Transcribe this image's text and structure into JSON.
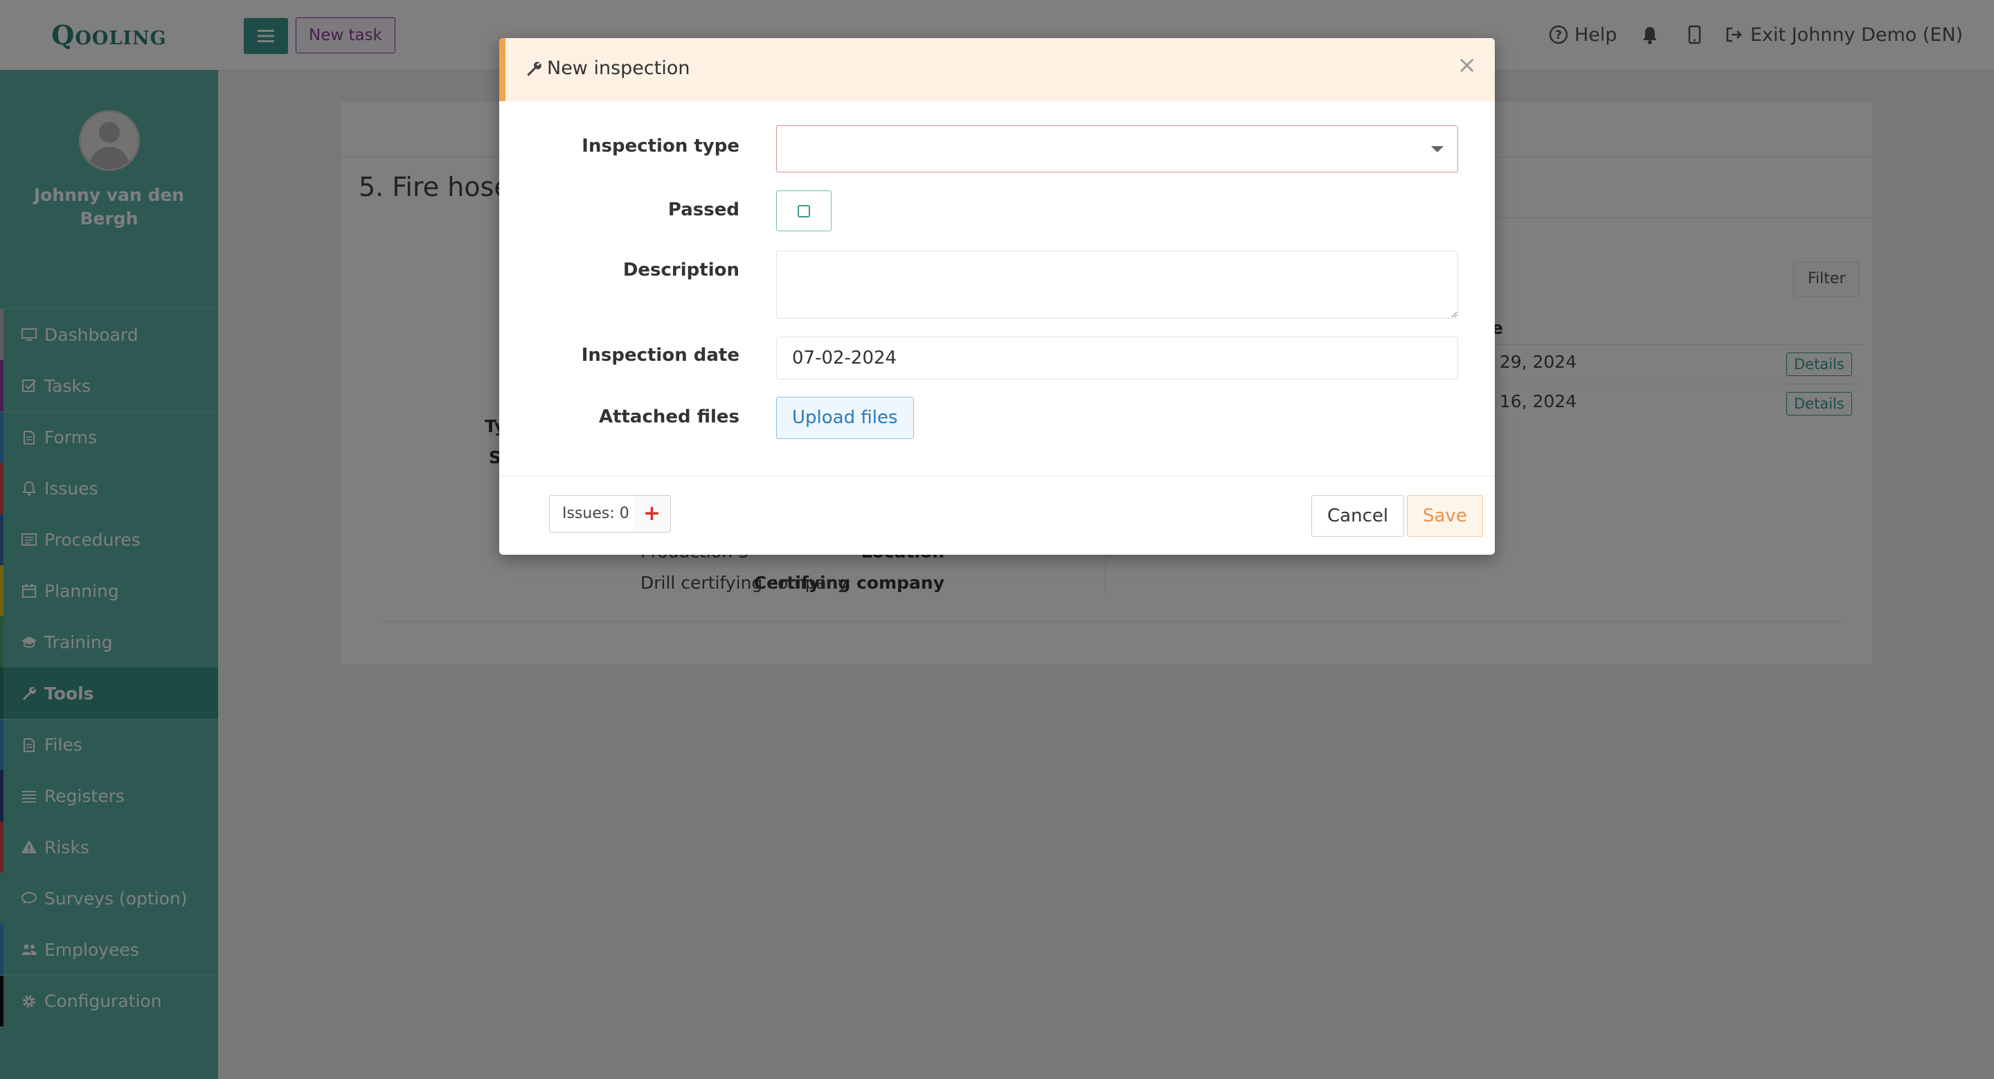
{
  "app": {
    "logo_text": "Qooling"
  },
  "header": {
    "new_task_label": "New task",
    "help_label": "Help",
    "exit_label": "Exit Johnny Demo (EN)"
  },
  "user": {
    "name": "Johnny van den Bergh"
  },
  "sidebar": {
    "items": [
      {
        "label": "Dashboard",
        "color": "#bdbdbd"
      },
      {
        "label": "Tasks",
        "color": "#8e3d9a"
      },
      {
        "label": "Forms",
        "color": "#3b8fd0"
      },
      {
        "label": "Issues",
        "color": "#d84a4a"
      },
      {
        "label": "Procedures",
        "color": "#4169b0"
      },
      {
        "label": "Planning",
        "color": "#e2c129"
      },
      {
        "label": "Training",
        "color": "#4ca96e"
      },
      {
        "label": "Tools",
        "color": "#2f7a6e"
      },
      {
        "label": "Files",
        "color": "#3b8fd0"
      },
      {
        "label": "Registers",
        "color": "#2e3f8f"
      },
      {
        "label": "Risks",
        "color": "#d84a4a"
      },
      {
        "label": "Surveys (option)",
        "color": "#5ab2a4"
      },
      {
        "label": "Employees",
        "color": "#3b8fd0"
      },
      {
        "label": "Configuration",
        "color": "#111111"
      }
    ]
  },
  "page": {
    "title": "5. Fire hose",
    "filter_label": "Filter",
    "date_column_fragment": "te",
    "rows": [
      {
        "date_fragment": "n 29, 2024",
        "details_label": "Details"
      },
      {
        "date_fragment": "n 16, 2024",
        "details_label": "Details"
      }
    ],
    "info": [
      {
        "label_fragment": "Ty"
      },
      {
        "label_fragment": "S"
      },
      {
        "label": "Location",
        "value": "Production 3"
      },
      {
        "label": "Certifying company",
        "value": "Drill certifying company"
      }
    ]
  },
  "modal": {
    "title": "New inspection",
    "close_label": "×",
    "fields": {
      "inspection_type_label": "Inspection type",
      "inspection_type_value": "",
      "passed_label": "Passed",
      "description_label": "Description",
      "description_value": "",
      "inspection_date_label": "Inspection date",
      "inspection_date_value": "07-02-2024",
      "attached_files_label": "Attached files",
      "upload_label": "Upload files"
    },
    "footer": {
      "issues_label": "Issues: 0",
      "add_issue_label": "+",
      "cancel_label": "Cancel",
      "save_label": "Save"
    }
  }
}
